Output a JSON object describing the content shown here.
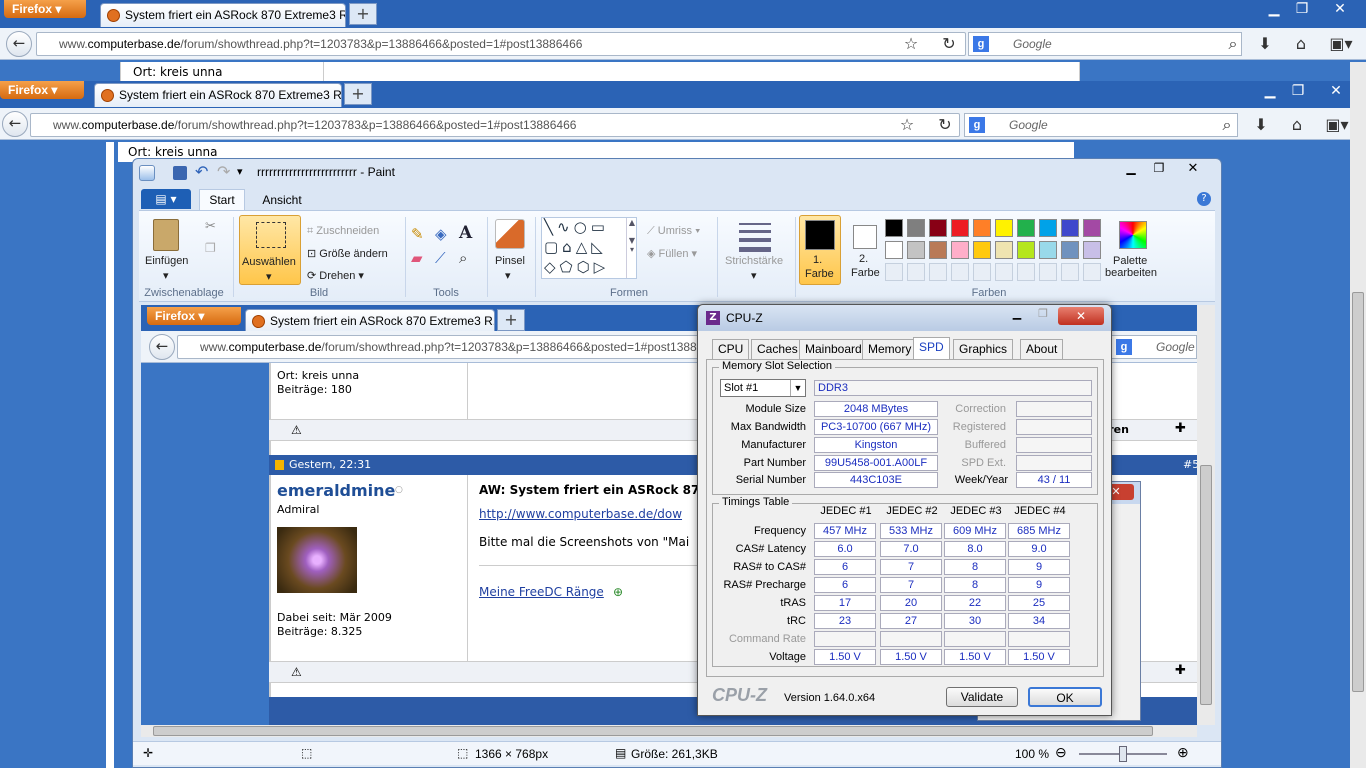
{
  "browser": {
    "firefox_label": "Firefox",
    "tab_title": "System friert ein ASRock 870 Extreme3 R...",
    "url_prefix": "www.",
    "url_domain": "computerbase.de",
    "url_path": "/forum/showthread.php?t=1203783&p=13886466&posted=1#post13886466",
    "search_placeholder": "Google",
    "new_tab": "+"
  },
  "forum": {
    "ort": "Ort: kreis unna",
    "beitraege1": "Beiträge: 180",
    "post_date": "Gestern, 22:31",
    "username": "emeraldmine",
    "rank": "Admiral",
    "post_title": "AW: System friert ein ASRock 870",
    "link": "http://www.computerbase.de/dow",
    "text": "Bitte mal die Screenshots von \"Mai",
    "signature": "Meine FreeDC Ränge",
    "joined": "Dabei seit: Mär 2009",
    "beitraege2": "Beiträge: 8.325",
    "quote_fragment": "ieren",
    "post_num": "#5",
    "small_text": "Meine FreeDC Range"
  },
  "paint": {
    "title": "rrrrrrrrrrrrrrrrrrrrrrrrr - Paint",
    "tab_start": "Start",
    "tab_view": "Ansicht",
    "paste": "Einfügen",
    "clipboard": "Zwischenablage",
    "select": "Auswählen",
    "crop": "Zuschneiden",
    "resize": "Größe ändern",
    "rotate": "Drehen",
    "image": "Bild",
    "tools": "Tools",
    "brush": "Pinsel",
    "shapes": "Formen",
    "outline": "Umriss",
    "fill": "Füllen",
    "stroke": "Strichstärke",
    "color1_a": "1.",
    "color1_b": "Farbe",
    "color2_a": "2.",
    "color2_b": "Farbe",
    "colors": "Farben",
    "edit_palette_a": "Palette",
    "edit_palette_b": "bearbeiten",
    "status_dims": "1366 × 768px",
    "status_size": "Größe: 261,3KB",
    "zoom": "100 %",
    "palette_colors": [
      "#000000",
      "#7f7f7f",
      "#880015",
      "#ed1c24",
      "#ff7f27",
      "#fff200",
      "#22b14c",
      "#00a2e8",
      "#3f48cc",
      "#a349a4",
      "#ffffff",
      "#c3c3c3",
      "#b97a57",
      "#ffaec9",
      "#ffc90e",
      "#efe4b0",
      "#b5e61d",
      "#99d9ea",
      "#7092be",
      "#c8bfe7"
    ]
  },
  "cpuz": {
    "title": "CPU-Z",
    "tabs": [
      "CPU",
      "Caches",
      "Mainboard",
      "Memory",
      "SPD",
      "Graphics",
      "About"
    ],
    "memory_slot_selection": "Memory Slot Selection",
    "slot": "Slot #1",
    "mem_type": "DDR3",
    "module_size_label": "Module Size",
    "module_size": "2048 MBytes",
    "max_bw_label": "Max Bandwidth",
    "max_bw": "PC3-10700 (667 MHz)",
    "manufacturer_label": "Manufacturer",
    "manufacturer": "Kingston",
    "part_label": "Part Number",
    "part": "99U5458-001.A00LF",
    "serial_label": "Serial Number",
    "serial": "443C103E",
    "correction_label": "Correction",
    "registered_label": "Registered",
    "buffered_label": "Buffered",
    "spdext_label": "SPD Ext.",
    "weekyear_label": "Week/Year",
    "weekyear": "43 / 11",
    "timings_table": "Timings Table",
    "jedec": [
      "JEDEC #1",
      "JEDEC #2",
      "JEDEC #3",
      "JEDEC #4"
    ],
    "row_labels": [
      "Frequency",
      "CAS# Latency",
      "RAS# to CAS#",
      "RAS# Precharge",
      "tRAS",
      "tRC",
      "Command Rate",
      "Voltage"
    ],
    "rows": [
      [
        "457 MHz",
        "533 MHz",
        "609 MHz",
        "685 MHz"
      ],
      [
        "6.0",
        "7.0",
        "8.0",
        "9.0"
      ],
      [
        "6",
        "7",
        "8",
        "9"
      ],
      [
        "6",
        "7",
        "8",
        "9"
      ],
      [
        "17",
        "20",
        "22",
        "25"
      ],
      [
        "23",
        "27",
        "30",
        "34"
      ],
      [
        "",
        "",
        "",
        ""
      ],
      [
        "1.50 V",
        "1.50 V",
        "1.50 V",
        "1.50 V"
      ]
    ],
    "logo": "CPU-Z",
    "version": "Version 1.64.0.x64",
    "validate": "Validate",
    "ok": "OK"
  }
}
